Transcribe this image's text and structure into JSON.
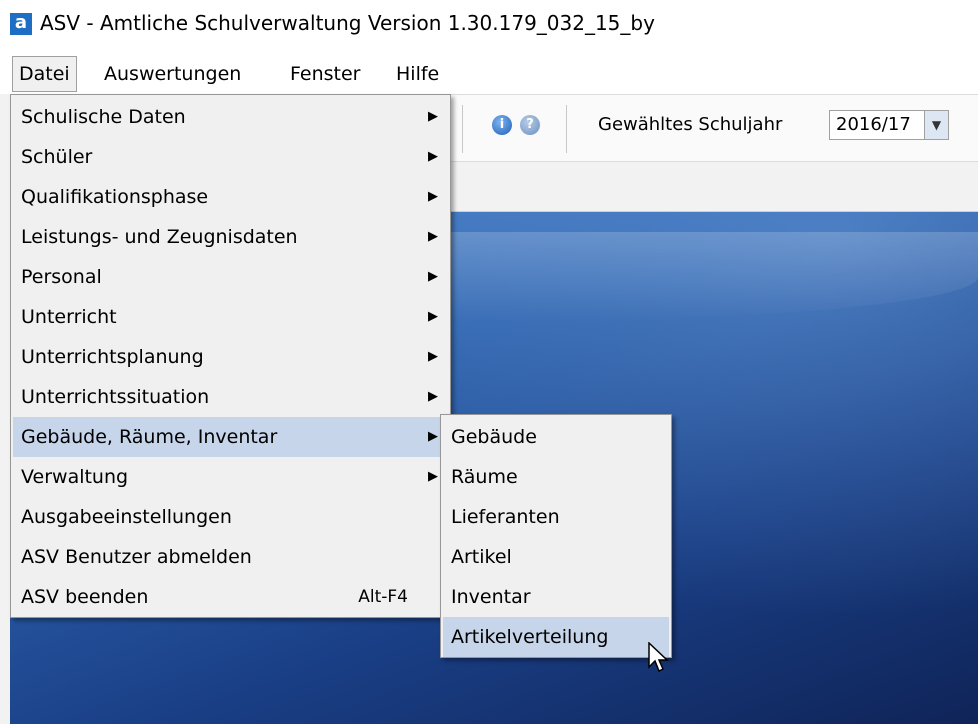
{
  "window": {
    "logo": "a",
    "title": "ASV - Amtliche Schulverwaltung Version 1.30.179_032_15_by"
  },
  "menubar": {
    "items": [
      "Datei",
      "Auswertungen",
      "Fenster",
      "Hilfe"
    ]
  },
  "toolbar": {
    "info_icon": "i",
    "help_icon": "?",
    "school_year_label": "Gewähltes Schuljahr",
    "school_year_value": "2016/17",
    "dropdown_icon": "▼"
  },
  "datei_menu": {
    "items": [
      {
        "label": "Schulische Daten",
        "arrow": "▶"
      },
      {
        "label": "Schüler",
        "arrow": "▶"
      },
      {
        "label": "Qualifikationsphase",
        "arrow": "▶"
      },
      {
        "label": "Leistungs- und Zeugnisdaten",
        "arrow": "▶"
      },
      {
        "label": "Personal",
        "arrow": "▶"
      },
      {
        "label": "Unterricht",
        "arrow": "▶"
      },
      {
        "label": "Unterrichtsplanung",
        "arrow": "▶"
      },
      {
        "label": "Unterrichtssituation",
        "arrow": "▶"
      },
      {
        "label": "Gebäude, Räume, Inventar",
        "arrow": "▶"
      },
      {
        "label": "Verwaltung",
        "arrow": "▶"
      },
      {
        "label": "Ausgabeeinstellungen"
      },
      {
        "label": "ASV Benutzer abmelden"
      },
      {
        "label": "ASV beenden",
        "accel": "Alt-F4"
      }
    ],
    "highlighted": "Gebäude, Räume, Inventar"
  },
  "submenu": {
    "items": [
      "Gebäude",
      "Räume",
      "Lieferanten",
      "Artikel",
      "Inventar",
      "Artikelverteilung"
    ],
    "highlighted": "Artikelverteilung"
  },
  "colors": {
    "menu_bg": "#f0f0f0",
    "menu_highlight": "#c6d5ea",
    "workspace": "#1a3f86"
  }
}
